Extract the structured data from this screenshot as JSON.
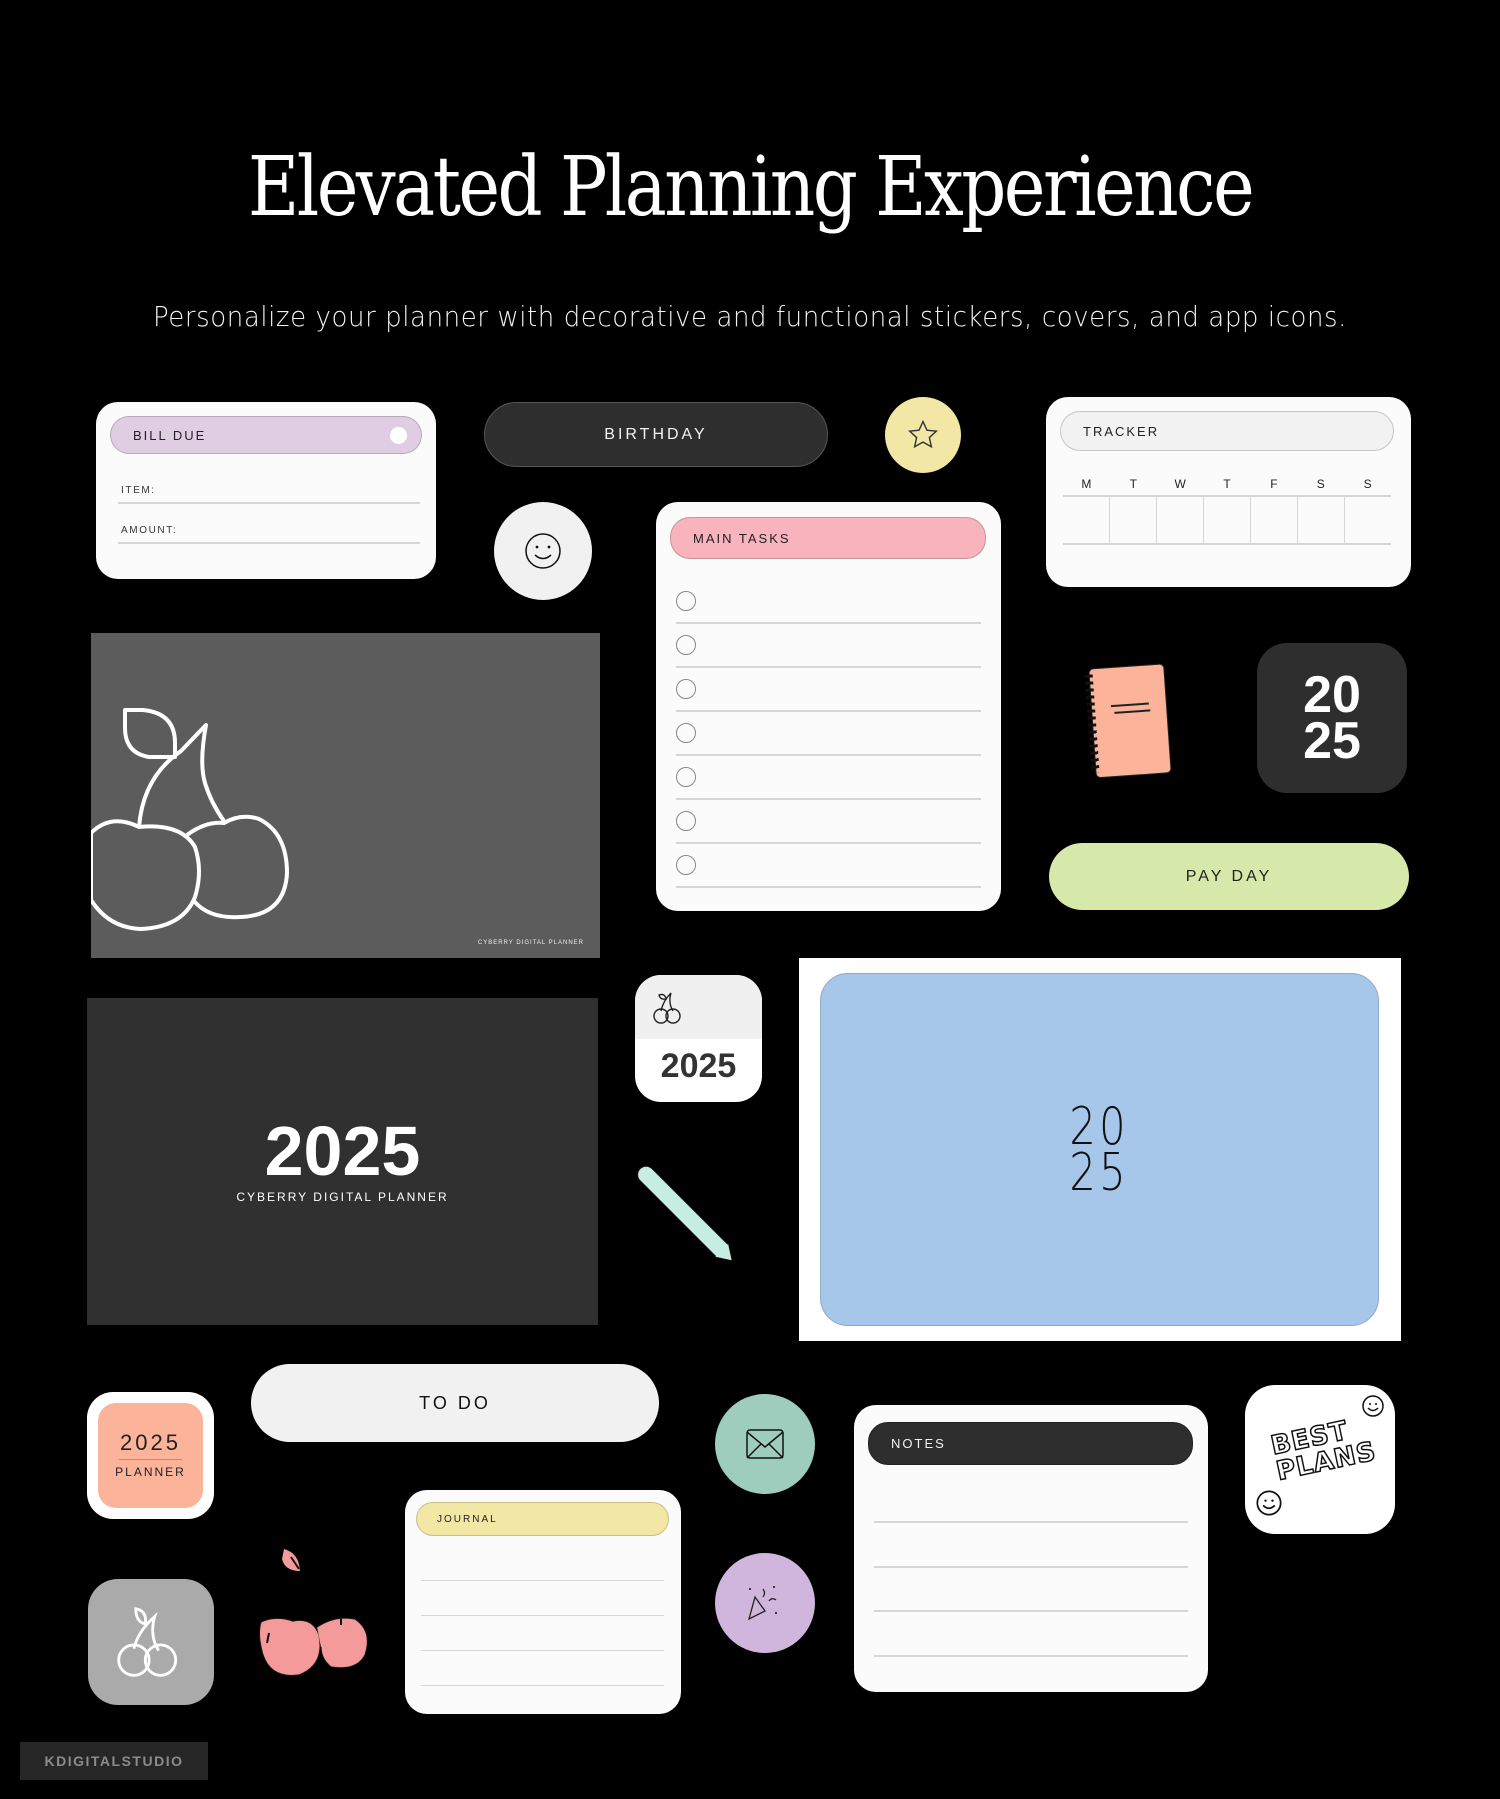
{
  "header": {
    "title": "Elevated Planning Experience",
    "subtitle": "Personalize your planner with decorative and functional stickers, covers, and app icons."
  },
  "stickers": {
    "bill_due": {
      "title": "BILL DUE",
      "fields": [
        "ITEM:",
        "AMOUNT:"
      ],
      "color": "#e0cde3"
    },
    "birthday": {
      "label": "BIRTHDAY",
      "color": "#2e2e2e"
    },
    "star": {
      "icon": "star-icon",
      "color": "#f3e7a6"
    },
    "smiley": {
      "icon": "smiley-icon",
      "color": "#f1f1f1"
    },
    "tracker": {
      "title": "TRACKER",
      "days": [
        "M",
        "T",
        "W",
        "T",
        "F",
        "S",
        "S"
      ]
    },
    "main_tasks": {
      "title": "MAIN TASKS",
      "rows": 7,
      "color": "#f8b3bc"
    },
    "notebook": {
      "icon": "notebook-icon",
      "color": "#fbb39a"
    },
    "year_tile": {
      "line1": "20",
      "line2": "25",
      "color": "#2e2e2e"
    },
    "pay_day": {
      "label": "PAY DAY",
      "color": "#d7e8ab"
    },
    "pencil": {
      "icon": "pencil-icon",
      "color": "#c7ece4"
    },
    "to_do": {
      "label": "TO DO",
      "color": "#f1f1f1"
    },
    "envelope": {
      "icon": "envelope-icon",
      "color": "#9fcdbd"
    },
    "party": {
      "icon": "party-popper-icon",
      "color": "#d0b6dc"
    },
    "notes": {
      "title": "NOTES",
      "color": "#2e2e2e"
    },
    "best_plans": {
      "line1": "BEST",
      "line2": "PLANS"
    },
    "journal": {
      "title": "JOURNAL",
      "color": "#f3e7a6"
    },
    "pink_cherries": {
      "icon": "cherries-icon",
      "color": "#f59a9a"
    }
  },
  "covers": {
    "cherry_cover": {
      "caption": "CYBERRY DIGITAL PLANNER",
      "color": "#5c5c5c"
    },
    "year_cover": {
      "year": "2025",
      "caption": "CYBERRY DIGITAL PLANNER",
      "color": "#303030"
    },
    "blue_cover": {
      "line1": "20",
      "line2": "25",
      "color": "#a6c7ea"
    }
  },
  "app_icons": {
    "cherry_year": {
      "year": "2025"
    },
    "planner": {
      "year": "2025",
      "label": "PLANNER",
      "color": "#fbb39a"
    },
    "gray_cherry": {
      "color": "#aaaaaa"
    }
  },
  "footer": {
    "brand": "KDIGITALSTUDIO"
  }
}
